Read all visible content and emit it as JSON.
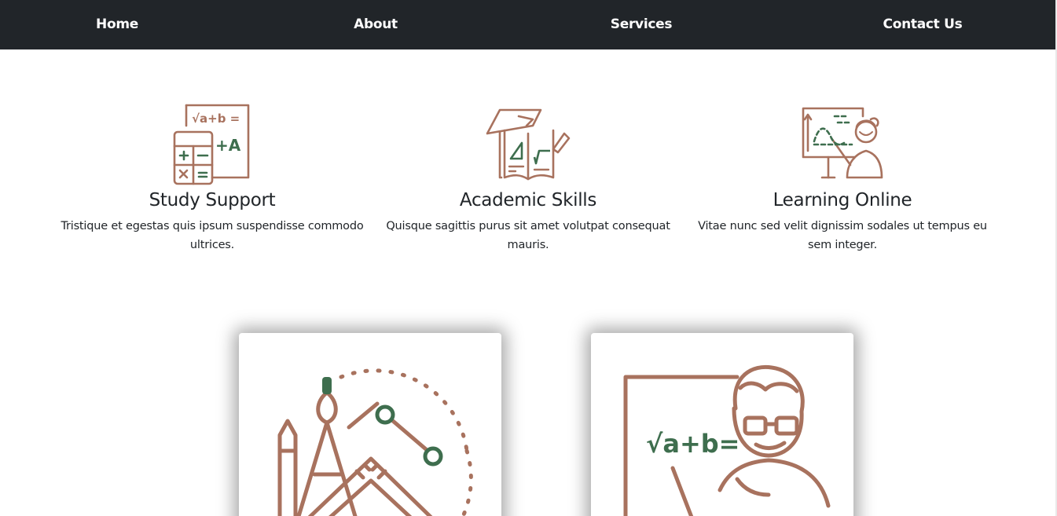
{
  "nav": {
    "items": [
      "Home",
      "About",
      "Services",
      "Contact Us"
    ]
  },
  "colors": {
    "brown": "#a8725e",
    "green": "#3e6e4e",
    "navbar": "#212529"
  },
  "features": [
    {
      "icon": "calculator-icon",
      "title": "Study Support",
      "text": "Tristique et egestas quis ipsum suspendisse commodo ultrices."
    },
    {
      "icon": "graduation-book-icon",
      "title": "Academic Skills",
      "text": "Quisque sagittis purus sit amet volutpat consequat mauris."
    },
    {
      "icon": "online-teacher-icon",
      "title": "Learning Online",
      "text": "Vitae nunc sed velit dignissim sodales ut tempus eu sem integer."
    }
  ],
  "cards": [
    {
      "icon": "geometry-tools-icon"
    },
    {
      "icon": "math-teacher-icon",
      "formula": "√a+b="
    }
  ],
  "icon_texts": {
    "calc_formula": "√a+b =",
    "calc_grade": "+A"
  }
}
